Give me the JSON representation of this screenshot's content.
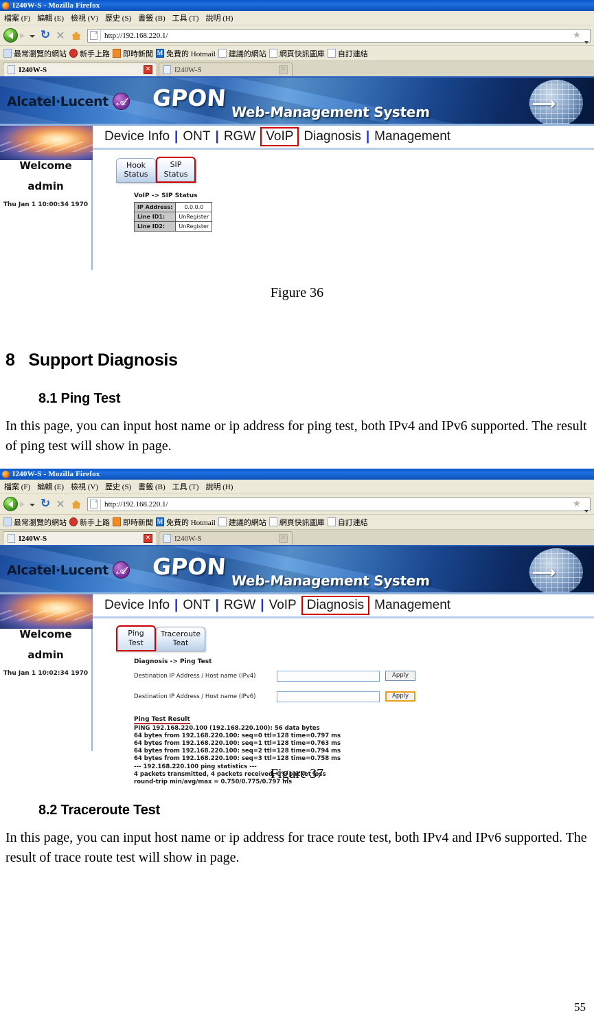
{
  "browser": {
    "window_title": "I240W-S - Mozilla Firefox",
    "menus": [
      "檔案 (F)",
      "編輯 (E)",
      "檢視 (V)",
      "歷史 (S)",
      "書籤 (B)",
      "工具 (T)",
      "說明 (H)"
    ],
    "url": "http://192.168.220.1/",
    "bookmarks": [
      "最常瀏覽的網站",
      "新手上路",
      "即時新聞",
      "免費的 Hotmail",
      "建議的網站",
      "網頁快訊圖庫",
      "自訂連結"
    ],
    "tabs": [
      {
        "label": "I240W-S",
        "active": true
      },
      {
        "label": "I240W-S",
        "active": false
      }
    ],
    "icons": {
      "back": "back-arrow-icon",
      "forward": "forward-arrow-icon",
      "reload": "reload-icon",
      "stop": "stop-icon",
      "home": "home-icon",
      "star": "★"
    }
  },
  "gpon": {
    "brand": "Alcatel·Lucent",
    "title": "GPON",
    "subtitle": "Web-Management System",
    "nav": [
      {
        "label": "Device Info",
        "selected": false
      },
      {
        "label": "ONT",
        "selected": false
      },
      {
        "label": "RGW",
        "selected": false
      },
      {
        "label": "VoIP",
        "selected": false
      },
      {
        "label": "Diagnosis",
        "selected": false
      },
      {
        "label": "Management",
        "selected": false
      }
    ],
    "sidebar": {
      "welcome": "Welcome",
      "user": "admin"
    }
  },
  "shot1": {
    "nav_selected": "VoIP",
    "datetime": "Thu Jan 1 10:00:34 1970",
    "tabs": [
      {
        "line1": "Hook",
        "line2": "Status",
        "selected": false
      },
      {
        "line1": "SIP",
        "line2": "Status",
        "selected": true
      }
    ],
    "panel_title": "VoIP -> SIP Status",
    "sip_table": [
      {
        "key": "IP Address:",
        "value": "0.0.0.0"
      },
      {
        "key": "Line ID1:",
        "value": "UnRegister"
      },
      {
        "key": "Line ID2:",
        "value": "UnRegister"
      }
    ]
  },
  "shot2": {
    "nav_selected": "Diagnosis",
    "datetime": "Thu Jan 1 10:02:34 1970",
    "tabs": [
      {
        "line1": "Ping",
        "line2": "Test",
        "selected": true
      },
      {
        "line1": "Traceroute",
        "line2": "Teat",
        "selected": false
      }
    ],
    "panel_title": "Diagnosis -> Ping Test",
    "rows": [
      {
        "label": "Destination IP Address / Host name (IPv4)",
        "value": "",
        "button": "Apply",
        "focused": false
      },
      {
        "label": "Destination IP Address / Host name (IPv6)",
        "value": "",
        "button": "Apply",
        "focused": true
      }
    ],
    "result_title": "Ping Test Result",
    "result_lines": [
      "PING 192.168.220.100 (192.168.220.100): 56 data bytes",
      "64 bytes from 192.168.220.100: seq=0 ttl=128 time=0.797 ms",
      "64 bytes from 192.168.220.100: seq=1 ttl=128 time=0.763 ms",
      "64 bytes from 192.168.220.100: seq=2 ttl=128 time=0.794 ms",
      "64 bytes from 192.168.220.100: seq=3 ttl=128 time=0.758 ms",
      "--- 192.168.220.100 ping statistics ---",
      "4 packets transmitted, 4 packets received, 0% packet loss",
      "round-trip min/avg/max = 0.750/0.775/0.797 ms"
    ]
  },
  "doc": {
    "figure36": "Figure 36",
    "figure37": "Figure 37",
    "section8_num": "8",
    "section8_title": "Support Diagnosis",
    "section81": "8.1    Ping Test",
    "para81": "In this page, you can input host name or ip address for ping test, both IPv4 and IPv6 supported. The result of ping test will show in page.",
    "section82": "8.2    Traceroute Test",
    "para82": "In this page, you can input host name or ip address for trace route test, both IPv4 and IPv6 supported. The result of trace route test will show in page.",
    "page_number": "55"
  },
  "colors": {
    "accent_red": "#cc0000",
    "title_blue": "#1e6fe0",
    "chrome_beige": "#ece9d8"
  }
}
